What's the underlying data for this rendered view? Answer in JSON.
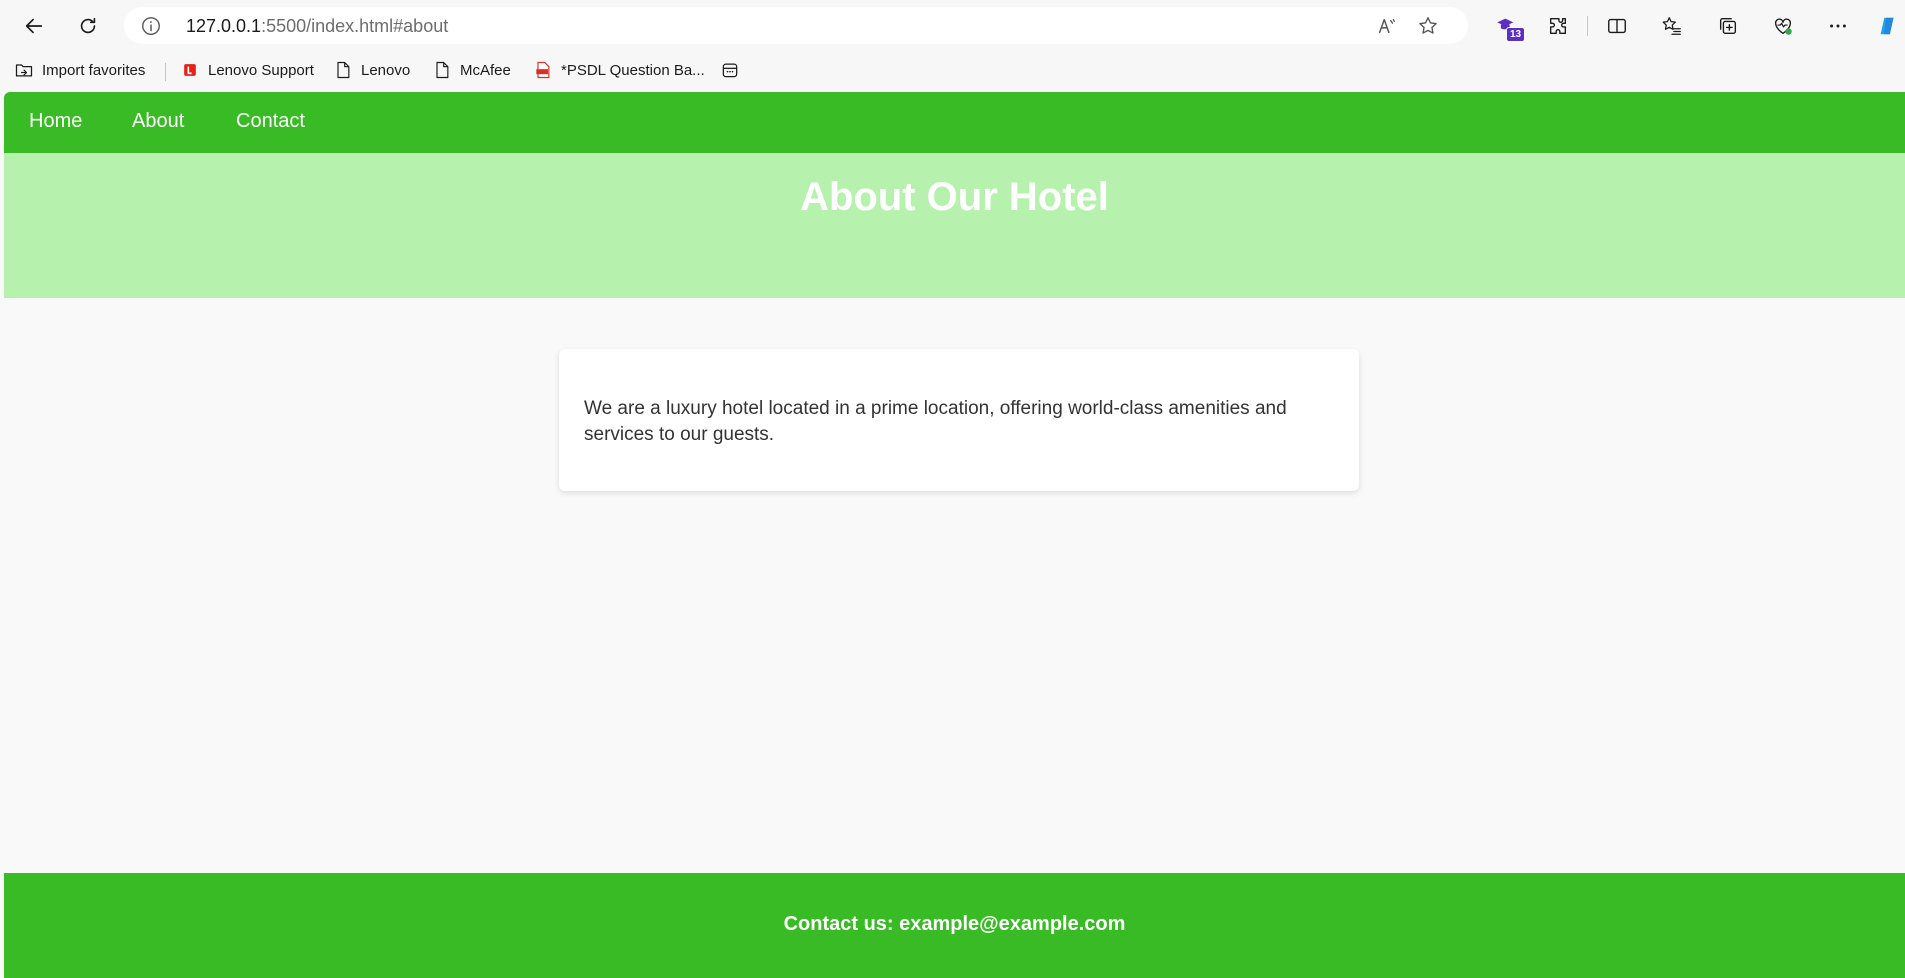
{
  "browser": {
    "url_host": "127.0.0.1",
    "url_rest": ":5500/index.html#about",
    "badge_count": "13",
    "bookmarks": [
      {
        "label": "Import favorites"
      },
      {
        "label": "Lenovo Support"
      },
      {
        "label": "Lenovo"
      },
      {
        "label": "McAfee"
      },
      {
        "label": "*PSDL Question Ba..."
      }
    ],
    "colors": {
      "chrome": "#f7f7f7",
      "badge": "#5b2fc7"
    }
  },
  "nav": {
    "links": [
      {
        "label": "Home"
      },
      {
        "label": "About"
      },
      {
        "label": "Contact"
      }
    ]
  },
  "hero": {
    "title": "About Our Hotel"
  },
  "about": {
    "text": "We are a luxury hotel located in a prime location, offering world-class amenities and services to our guests."
  },
  "footer": {
    "text": "Contact us: example@example.com"
  },
  "colors": {
    "nav": "#39bb25",
    "hero": "#b6f2ae",
    "page": "#f9f9f9"
  }
}
